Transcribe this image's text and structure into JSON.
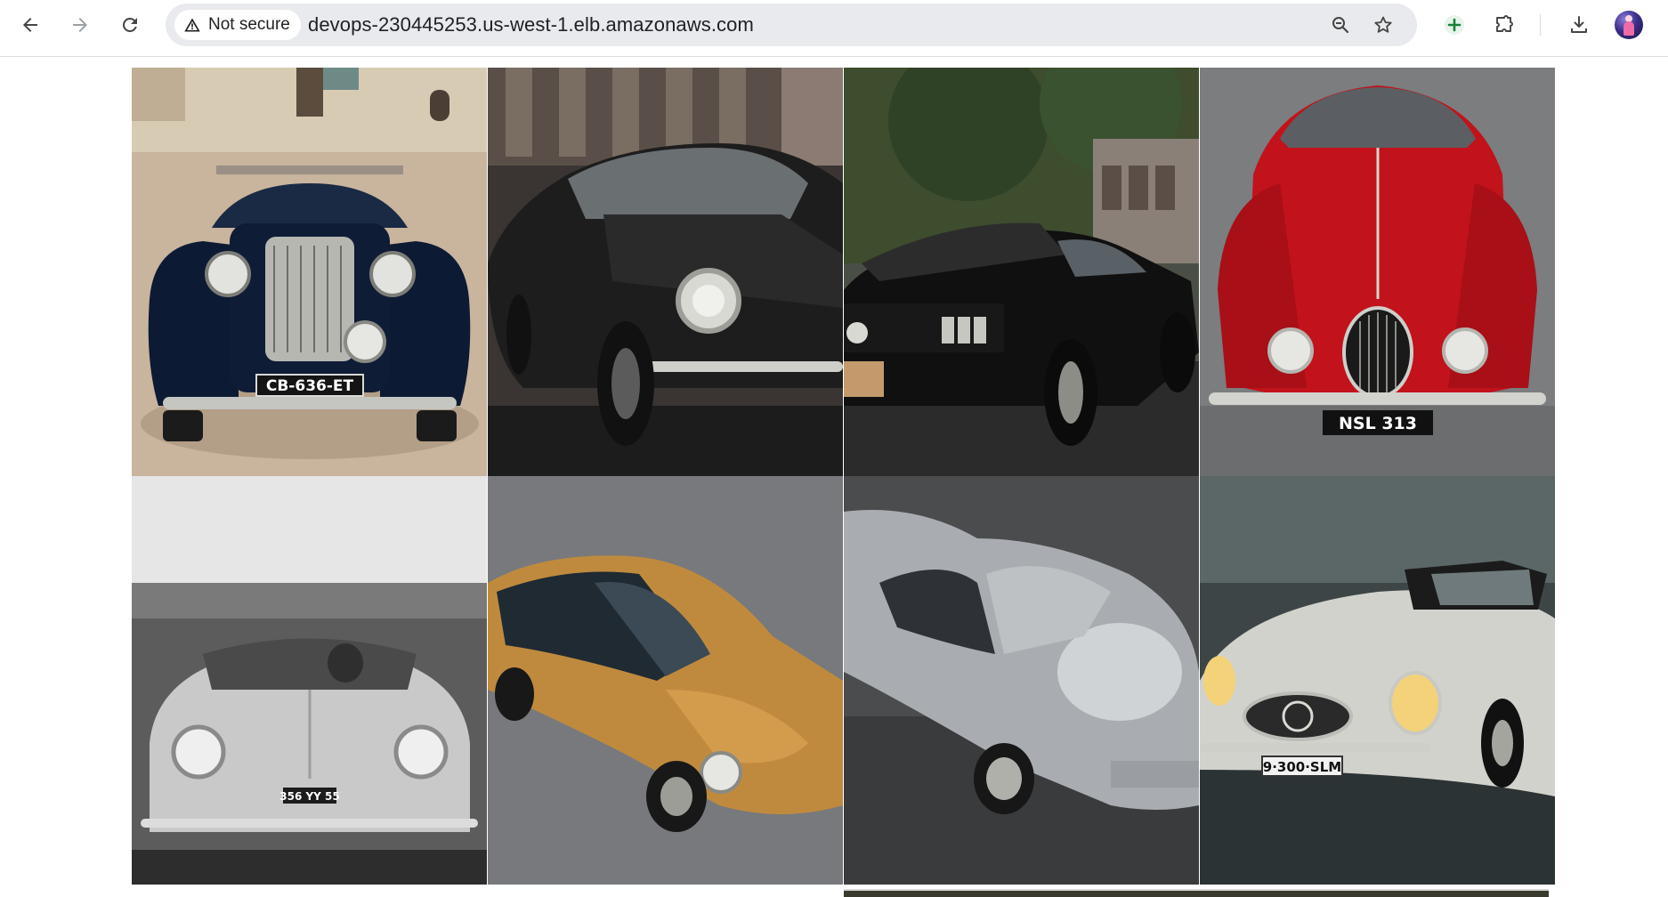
{
  "browser": {
    "security_label": "Not secure",
    "url": "devops-230445253.us-west-1.elb.amazonaws.com",
    "icons": {
      "back": "arrow-left-icon",
      "forward": "arrow-right-icon",
      "reload": "reload-icon",
      "warning": "warning-triangle-icon",
      "zoom": "zoom-out-icon",
      "bookmark": "star-icon",
      "extension_add": "plus-circle-icon",
      "extensions": "puzzle-icon",
      "downloads": "download-icon",
      "profile": "avatar"
    }
  },
  "gallery": {
    "photos": [
      {
        "plate": "CB-636-ET",
        "car_color": "#0d1a33"
      },
      {
        "plate": "",
        "car_color": "#1c1c1c"
      },
      {
        "plate": "",
        "car_color": "#141414"
      },
      {
        "plate": "NSL 313",
        "car_color": "#c2121b"
      },
      {
        "plate": "356 YY 55",
        "car_color": "#b9b9b9"
      },
      {
        "plate": "",
        "car_color": "#c08a3e"
      },
      {
        "plate": "",
        "car_color": "#a9adb1"
      },
      {
        "plate": "9·300·SLM",
        "car_color": "#d2d2cc"
      }
    ]
  }
}
